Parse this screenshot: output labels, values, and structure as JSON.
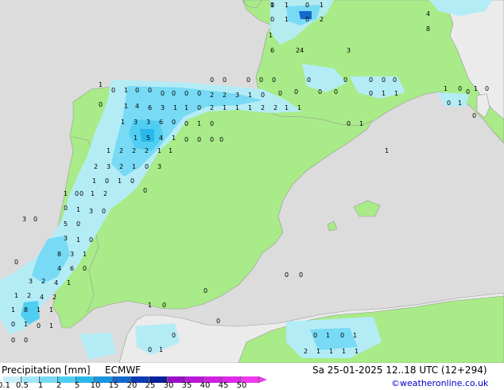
{
  "title": "Precipitation [mm]",
  "model": "ECMWF",
  "datetime": "Sa 25-01-2025 12..18 UTC (12+294)",
  "copyright": "©weatheronline.co.uk",
  "legend": {
    "ticks": [
      "0.1",
      "0.5",
      "1",
      "2",
      "5",
      "10",
      "15",
      "20",
      "25",
      "30",
      "35",
      "40",
      "45",
      "50"
    ],
    "colors": [
      "#c8f0f8",
      "#a0e6f6",
      "#78daf4",
      "#50cef2",
      "#28b8ec",
      "#1a96e0",
      "#1468cc",
      "#0c3cb4",
      "#08209a",
      "#9a10c8",
      "#b818d8",
      "#d020e0",
      "#e028e8",
      "#f038f0"
    ]
  },
  "colors": {
    "sea": "#dcdcdc",
    "land_in_domain": "#a8eb88",
    "land_outside": "#ebebeb",
    "border": "#999999"
  },
  "map_values": [
    "0",
    "1",
    "0",
    "1",
    "0",
    "1",
    "0",
    "2",
    "1",
    "6",
    "24",
    "3",
    "4",
    "8",
    "0",
    "0",
    "0",
    "0",
    "0",
    "0",
    "0",
    "0",
    "0",
    "0",
    "1",
    "0",
    "1",
    "0",
    "0",
    "0",
    "0",
    "0",
    "0",
    "2",
    "2",
    "3",
    "1",
    "0",
    "0",
    "1",
    "1",
    "0",
    "0",
    "0",
    "0",
    "1",
    "0",
    "0",
    "1",
    "0",
    "0",
    "1",
    "4",
    "6",
    "3",
    "1",
    "1",
    "0",
    "2",
    "1",
    "1",
    "1",
    "2",
    "2",
    "1",
    "1",
    "0",
    "1",
    "0",
    "1",
    "3",
    "3",
    "6",
    "0",
    "0",
    "1",
    "0",
    "0",
    "1",
    "1",
    "5",
    "4",
    "1",
    "0",
    "0",
    "0",
    "0",
    "1",
    "2",
    "2",
    "2",
    "1",
    "1",
    "2",
    "3",
    "2",
    "1",
    "0",
    "3",
    "1",
    "0",
    "1",
    "0",
    "0",
    "1",
    "0",
    "1",
    "2",
    "1",
    "0",
    "0",
    "0",
    "1",
    "3",
    "0",
    "3",
    "5",
    "0",
    "3",
    "1",
    "0",
    "8",
    "3",
    "1",
    "4",
    "6",
    "0",
    "3",
    "2",
    "4",
    "1",
    "0",
    "1",
    "2",
    "4",
    "2",
    "1",
    "8",
    "1",
    "1",
    "0",
    "1",
    "0",
    "1",
    "0",
    "0",
    "1",
    "0",
    "0",
    "0",
    "0",
    "0",
    "0",
    "1",
    "0",
    "1",
    "2",
    "1",
    "1",
    "1",
    "1",
    "1",
    "0",
    "0",
    "1"
  ]
}
